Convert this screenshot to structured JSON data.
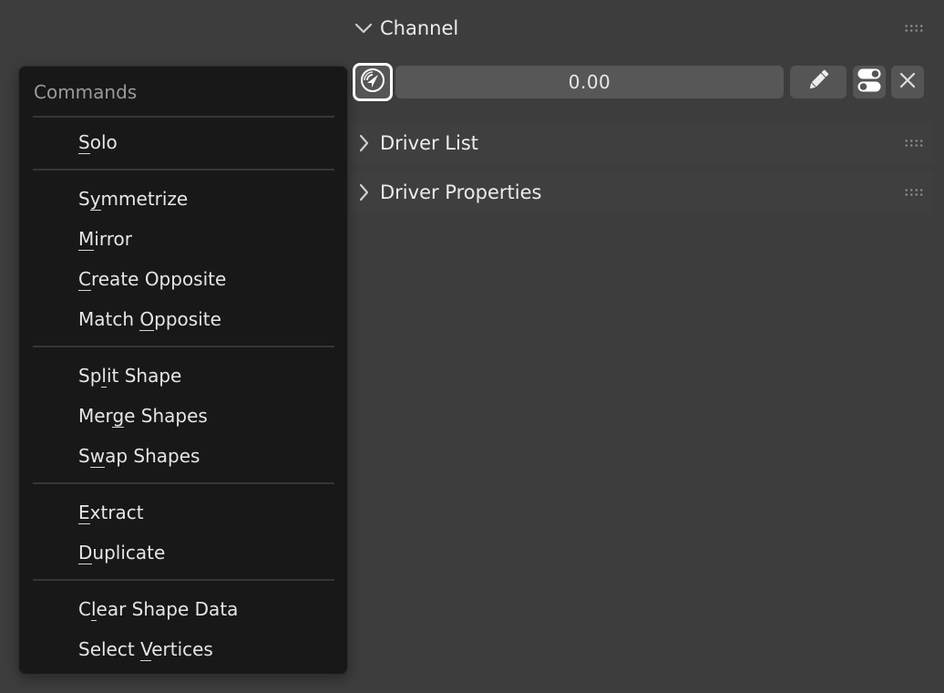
{
  "properties": {
    "channel_header": "Channel",
    "driver_list_header": "Driver List",
    "driver_properties_header": "Driver Properties",
    "channel_value": "0.00"
  },
  "menu": {
    "title": "Commands",
    "groups": [
      [
        {
          "label": "Solo",
          "underline": "S"
        }
      ],
      [
        {
          "label": "Symmetrize",
          "underline": "y"
        },
        {
          "label": "Mirror",
          "underline": "M"
        },
        {
          "label": "Create Opposite",
          "underline": "C"
        },
        {
          "label": "Match Opposite",
          "underline": "O"
        }
      ],
      [
        {
          "label": "Split Shape",
          "underline": "l"
        },
        {
          "label": "Merge Shapes",
          "underline": "g"
        },
        {
          "label": "Swap Shapes",
          "underline": "w"
        }
      ],
      [
        {
          "label": "Extract",
          "underline": "E"
        },
        {
          "label": "Duplicate",
          "underline": "D"
        }
      ],
      [
        {
          "label": "Clear Shape Data",
          "underline": "l"
        },
        {
          "label": "Select Vertices",
          "underline": "V"
        }
      ]
    ]
  },
  "icons": {
    "driver": "driver-icon",
    "edit": "pencil-icon",
    "toggle": "toggle-icon",
    "remove": "close-icon",
    "expand": "chevron-down-icon",
    "collapsed": "chevron-right-icon",
    "grip": "drag-grip-icon"
  },
  "colors": {
    "background": "#3d3d3d",
    "menu_background": "#181818",
    "field": "#575757",
    "button": "#555555",
    "text": "#e6e6e6",
    "muted_text": "#9a9a9a"
  }
}
